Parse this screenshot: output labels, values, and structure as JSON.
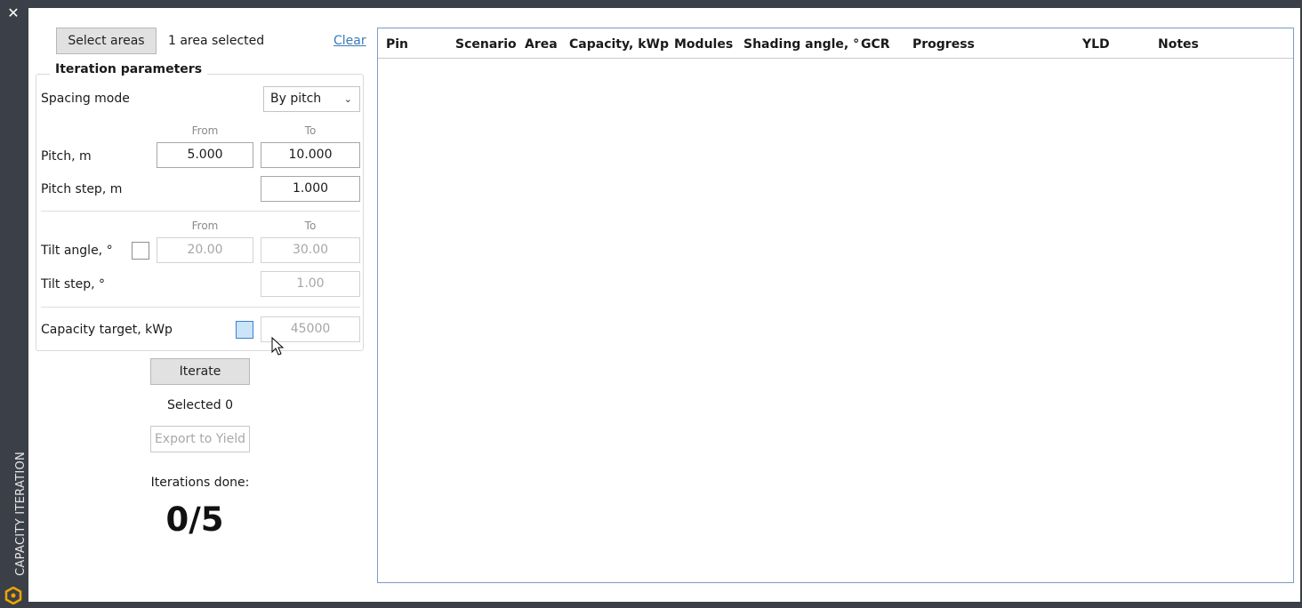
{
  "window": {
    "title": "CAPACITY ITERATION",
    "close_icon": "close-icon",
    "logo_icon": "app-logo-icon",
    "accent_color": "#f0a500"
  },
  "top": {
    "select_areas_label": "Select areas",
    "selection_status": "1 area selected",
    "clear_label": "Clear"
  },
  "iteration": {
    "title": "Iteration parameters",
    "spacing_mode_label": "Spacing mode",
    "spacing_mode_value": "By pitch",
    "from_header": "From",
    "to_header": "To",
    "pitch_label": "Pitch, m",
    "pitch_from": "5.000",
    "pitch_to": "10.000",
    "pitch_step_label": "Pitch step, m",
    "pitch_step": "1.000",
    "tilt_label": "Tilt angle, °",
    "tilt_from": "20.00",
    "tilt_to": "30.00",
    "tilt_step_label": "Tilt step, °",
    "tilt_step": "1.00",
    "capacity_target_label": "Capacity target, kWp",
    "capacity_target": "45000"
  },
  "actions": {
    "iterate_label": "Iterate",
    "selected_text": "Selected 0",
    "export_label": "Export to Yield",
    "iterations_done_label": "Iterations done:",
    "iterations_done_value": "0/5"
  },
  "results": {
    "columns": [
      "Pin",
      "Scenario",
      "Area",
      "Capacity, kWp",
      "Modules",
      "Shading angle, °",
      "GCR",
      "Progress",
      "YLD",
      "Notes"
    ],
    "rows": []
  }
}
